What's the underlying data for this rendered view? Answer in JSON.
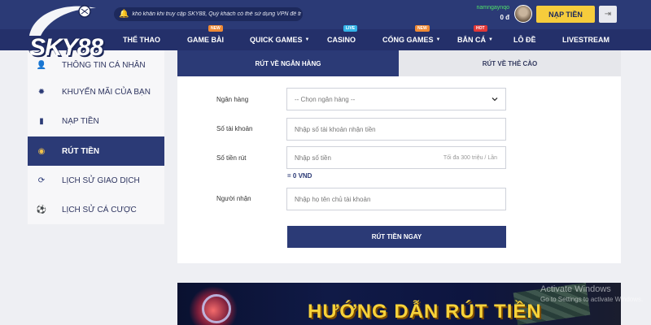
{
  "header": {
    "logo_text": "SKY88",
    "notice": "khó khăn khi truy cập SKY88, Quý khách có thể sử dụng VPN để tr",
    "username": "namngaynqo",
    "balance": "0 đ",
    "deposit_label": "NẠP TIỀN",
    "logout_icon": "logout-icon"
  },
  "nav": {
    "items": [
      {
        "label": "THỂ THAO",
        "badge": "",
        "caret": false
      },
      {
        "label": "GAME BÀI",
        "badge": "NEW",
        "caret": false
      },
      {
        "label": "QUICK GAMES",
        "badge": "",
        "caret": true
      },
      {
        "label": "CASINO",
        "badge": "LIVE",
        "caret": false
      },
      {
        "label": "CỔNG GAMES",
        "badge": "NEW",
        "caret": true
      },
      {
        "label": "BẮN CÁ",
        "badge": "HOT",
        "caret": true
      },
      {
        "label": "LÔ ĐỀ",
        "badge": "",
        "caret": false
      },
      {
        "label": "LIVESTREAM",
        "badge": "",
        "caret": false
      }
    ]
  },
  "sidebar": {
    "items": [
      {
        "label": "THÔNG TIN CÁ NHÂN",
        "icon": "user-icon",
        "active": false
      },
      {
        "label": "KHUYẾN MÃI CỦA BẠN",
        "icon": "gift-icon",
        "active": false
      },
      {
        "label": "NẠP TIỀN",
        "icon": "deposit-icon",
        "active": false
      },
      {
        "label": "RÚT TIỀN",
        "icon": "withdraw-icon",
        "active": true
      },
      {
        "label": "LỊCH SỬ GIAO DỊCH",
        "icon": "history-icon",
        "active": false
      },
      {
        "label": "LỊCH SỬ CÁ CƯỢC",
        "icon": "ball-icon",
        "active": false
      }
    ]
  },
  "withdraw": {
    "tabs": {
      "bank": "RÚT VỀ NGÂN HÀNG",
      "card": "RÚT VỀ THẺ CÀO"
    },
    "bank_label": "Ngân hàng",
    "bank_select": "-- Chọn ngân hàng --",
    "account_label": "Số tài khoản",
    "account_placeholder": "Nhập số tài khoản nhận tiền",
    "amount_label": "Số tiền rút",
    "amount_placeholder": "Nhập số tiền",
    "amount_hint": "Tối đa 300 triệu / Lần",
    "amount_equiv": "= 0 VND",
    "receiver_label": "Người nhận",
    "receiver_placeholder": "Nhập họ tên chủ tài khoản",
    "submit_label": "RÚT TIỀN NGAY"
  },
  "banner": {
    "title": "HƯỚNG DẪN RÚT TIỀN"
  },
  "watermark": {
    "line1": "Activate Windows",
    "line2": "Go to Settings to activate Windows."
  }
}
